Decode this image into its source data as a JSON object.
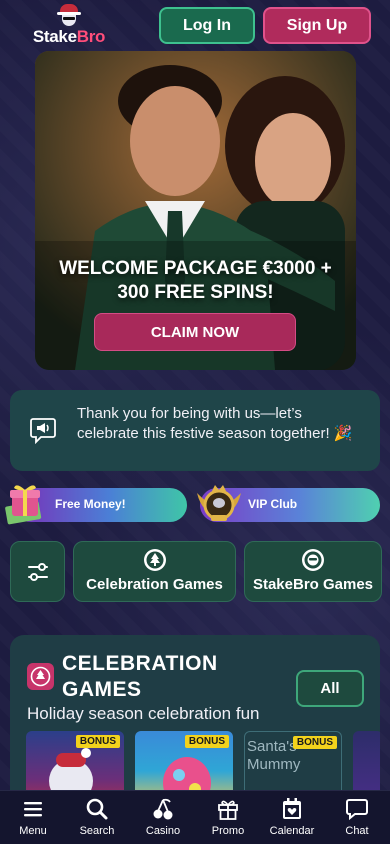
{
  "brand": {
    "name_part1": "Stake",
    "name_part2": "Bro"
  },
  "header": {
    "login_label": "Log In",
    "signup_label": "Sign Up"
  },
  "hero": {
    "title_line1": "WELCOME PACKAGE €3000 +",
    "title_line2": "300 FREE SPINS!",
    "cta_label": "CLAIM NOW"
  },
  "notice": {
    "text": "Thank you for being with us—let’s celebrate this festive season together! 🎉"
  },
  "promos": [
    {
      "label": "Free Money!",
      "icon": "gift-icon"
    },
    {
      "label": "VIP Club",
      "icon": "vip-crest-icon"
    }
  ],
  "categories": [
    {
      "label": "",
      "icon": "filter-sliders-icon"
    },
    {
      "label": "Celebration Games",
      "icon": "tree-icon"
    },
    {
      "label": "StakeBro Games",
      "icon": "mascot-icon"
    }
  ],
  "section": {
    "title": "CELEBRATION GAMES",
    "subtitle": "Holiday season celebration fun",
    "all_label": "All"
  },
  "games": [
    {
      "badge": "BONUS",
      "alt": ""
    },
    {
      "badge": "BONUS",
      "alt": ""
    },
    {
      "badge": "BONUS",
      "alt": "Santa's Mummy"
    },
    {
      "badge": "",
      "alt": ""
    }
  ],
  "nav": [
    {
      "label": "Menu",
      "icon": "menu-icon"
    },
    {
      "label": "Search",
      "icon": "search-icon"
    },
    {
      "label": "Casino",
      "icon": "cherries-icon"
    },
    {
      "label": "Promo",
      "icon": "gift-icon"
    },
    {
      "label": "Calendar",
      "icon": "calendar-heart-icon"
    },
    {
      "label": "Chat",
      "icon": "chat-icon"
    }
  ],
  "colors": {
    "background": "#1d1c40",
    "login_green": "#1a6a4e",
    "signup_pink": "#b02b5c",
    "panel_teal": "#1f4549",
    "badge_yellow": "#f2d21c"
  }
}
